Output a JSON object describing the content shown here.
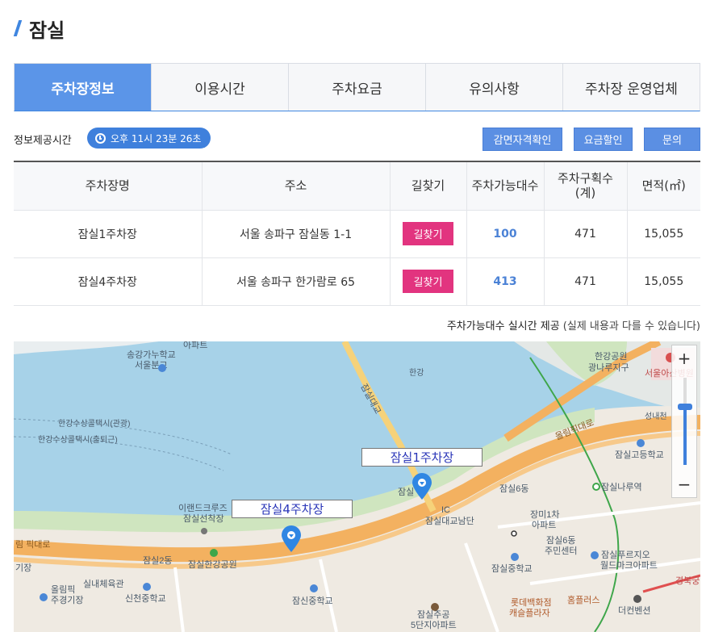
{
  "page": {
    "title": "잠실"
  },
  "tabs": [
    {
      "label": "주차장정보",
      "active": true
    },
    {
      "label": "이용시간"
    },
    {
      "label": "주차요금"
    },
    {
      "label": "유의사항"
    },
    {
      "label": "주차장 운영업체"
    }
  ],
  "info": {
    "label": "정보제공시간",
    "time": "오후 11시 23분 26초",
    "buttons": [
      "감면자격확인",
      "요금할인",
      "문의"
    ]
  },
  "table": {
    "headers": [
      "주차장명",
      "주소",
      "길찾기",
      "주차가능대수",
      "주차구획수(계)",
      "면적(㎡)"
    ],
    "header_lines": {
      "h4a": "주차구획수",
      "h4b": "(계)"
    },
    "rows": [
      {
        "name": "잠실1주차장",
        "address": "서울 송파구 잠실동 1-1",
        "route": "길찾기",
        "available": "100",
        "spaces": "471",
        "area": "15,055"
      },
      {
        "name": "잠실4주차장",
        "address": "서울 송파구 한가람로 65",
        "route": "길찾기",
        "available": "413",
        "spaces": "471",
        "area": "15,055"
      }
    ]
  },
  "note": {
    "main": "주차가능대수 실시간 제공",
    "sub": "(실제 내용과 다를 수 있습니다)"
  },
  "map": {
    "zoom_in": "+",
    "zoom_out": "−",
    "markers": [
      "잠실1주차장",
      "잠실4주차장"
    ],
    "places": {
      "p1": "송강가누학교",
      "p2": "서울분교",
      "p3": "한강수상콜택시(관광)",
      "p4": "한강수상콜택시(출퇴근)",
      "p5": "잠실대교",
      "p6": "한강",
      "p7": "한강공원",
      "p8": "광나루지구",
      "p9": "서울아산병원",
      "p10": "성내천",
      "p11": "올림픽대로",
      "p12": "잠실고등학교",
      "p13": "잠실6동",
      "p14": "잠실나루역",
      "p15": "잠실대교남단",
      "p16": "장미1차",
      "p17": "아파트",
      "p18": "잠실6동",
      "p19": "주민센터",
      "p20": "이랜드크루즈",
      "p21": "잠실선착장",
      "p22": "잠실2동",
      "p23": "잠실한강공원",
      "p24": "올림픽",
      "p25": "주경기장",
      "p26": "실내체육관",
      "p27": "신천중학교",
      "p28": "잠신중학교",
      "p29": "잠실주공",
      "p30": "5단지아파트",
      "p31": "잠실중학교",
      "p32": "잠실푸르지오",
      "p33": "월드마크아파트",
      "p34": "롯데백화점",
      "p35": "캐슬플라자",
      "p36": "홈플러스",
      "p37": "더컨벤션",
      "p38": "경북궁",
      "p39": "기장",
      "p40": "아파트",
      "p41": "잠실",
      "p42": "IC",
      "p43": "림 픽대로"
    }
  },
  "colors": {
    "accent": "#5b95e8",
    "badge": "#3f80dc",
    "route": "#e2347f",
    "available": "#4b82d6",
    "water": "#a7d2e8"
  }
}
